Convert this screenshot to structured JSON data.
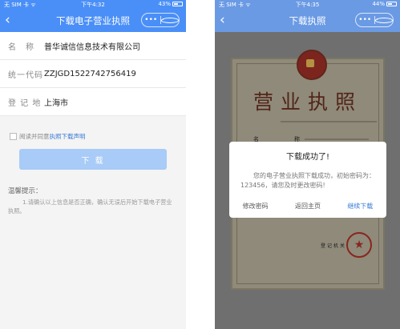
{
  "left": {
    "status": {
      "carrier": "无 SIM 卡 ᯤ",
      "time": "下午4:32",
      "battery": "43%",
      "battery_level": 0.43
    },
    "nav": {
      "back": "‹",
      "title": "下载电子营业执照",
      "more": "•••"
    },
    "fields": [
      {
        "label": "名　称",
        "value": "普华诚信信息技术有限公司"
      },
      {
        "label": "统一代码",
        "value": "ZZJGD1522742756419"
      },
      {
        "label": "登 记 地",
        "value": "上海市"
      }
    ],
    "agreement": {
      "prefix": "阅读并同意",
      "link": "执照下载声明"
    },
    "download_button": "下 载",
    "tips": {
      "title": "温馨提示：",
      "body": "1.请确认以上信息是否正确，确认无误后开始下载电子营业执照。"
    }
  },
  "right": {
    "status": {
      "carrier": "无 SIM 卡 ᯤ",
      "time": "下午4:35",
      "battery": "44%",
      "battery_level": 0.44
    },
    "nav": {
      "back": "‹",
      "title": "下载执照",
      "more": "•••"
    },
    "certificate": {
      "title": "营业执照",
      "name_label": "名　　称",
      "issuing_org": "登记机关",
      "seal": "★"
    },
    "dialog": {
      "title": "下载成功了!",
      "message": "您的电子营业执照下载成功，初始密码为：123456，请您及时更改密码!",
      "actions": [
        "修改密码",
        "返回主页",
        "继续下载"
      ]
    }
  }
}
